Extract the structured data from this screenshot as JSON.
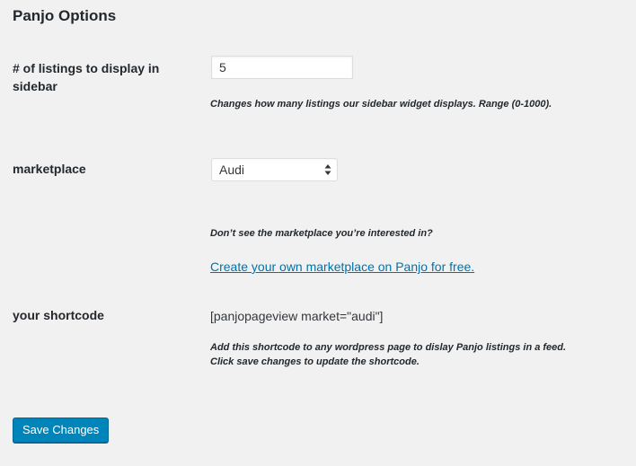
{
  "page": {
    "title": "Panjo Options"
  },
  "listings": {
    "label": "# of listings to display in sidebar",
    "value": "5",
    "description": "Changes how many listings our sidebar widget displays. Range (0-1000)."
  },
  "marketplace": {
    "label": "marketplace",
    "selected": "Audi",
    "description": "Don’t see the marketplace you’re interested in?",
    "link_text": "Create your own marketplace on Panjo for free."
  },
  "shortcode": {
    "label": "your shortcode",
    "value": "[panjopageview market=\"audi\"]",
    "description_line1": "Add this shortcode to any wordpress page to dislay Panjo listings in a feed.",
    "description_line2": "Click save changes to update the shortcode."
  },
  "actions": {
    "save_label": "Save Changes"
  },
  "colors": {
    "background": "#f1f1f1",
    "link": "#0073aa",
    "primary_button": "#0085ba"
  }
}
